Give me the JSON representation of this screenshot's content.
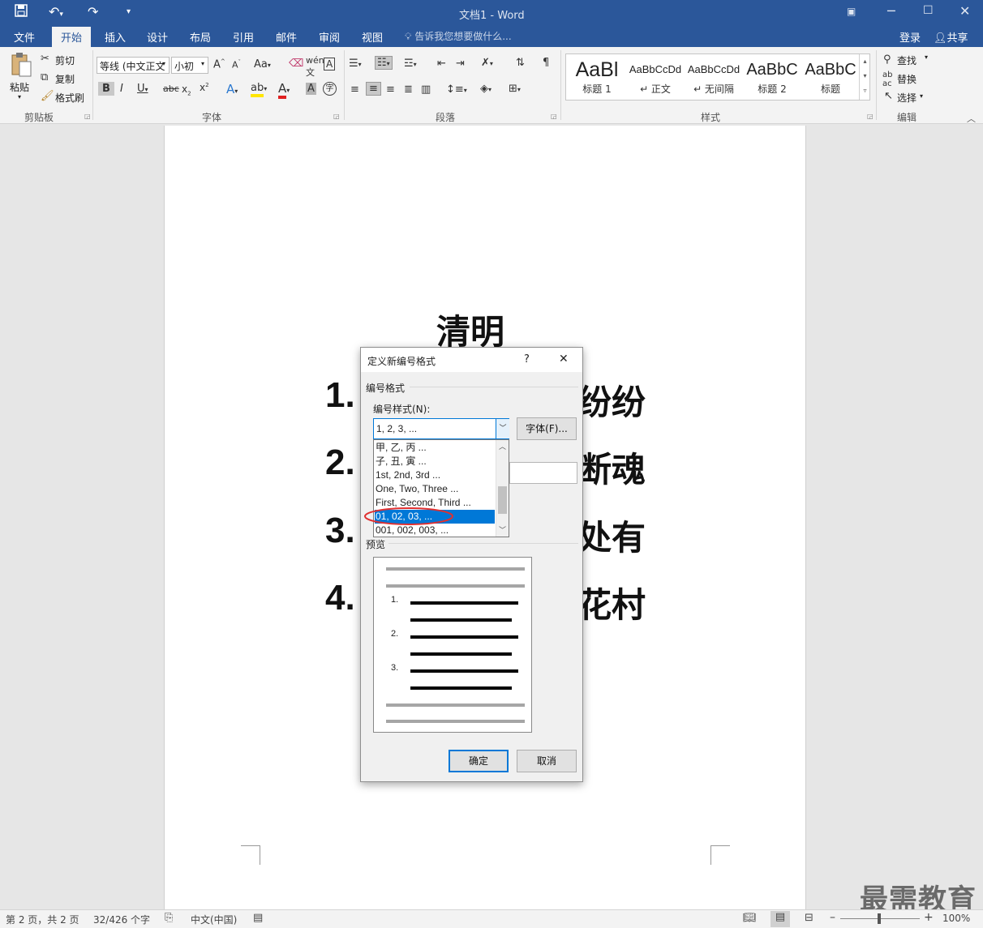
{
  "window": {
    "title": "文档1 - Word"
  },
  "qat": {
    "save_icon": "save-icon",
    "undo_icon": "undo-icon",
    "redo_icon": "redo-icon",
    "customize": "▾"
  },
  "tabs": [
    "文件",
    "开始",
    "插入",
    "设计",
    "布局",
    "引用",
    "邮件",
    "审阅",
    "视图"
  ],
  "tell_me": "告诉我您想要做什么...",
  "login": "登录",
  "share": "共享",
  "ribbon": {
    "clipboard": {
      "label": "剪贴板",
      "paste": "粘贴",
      "cut": "剪切",
      "copy": "复制",
      "format_painter": "格式刷"
    },
    "font": {
      "label": "字体",
      "font_name": "等线 (中文正文",
      "font_size": "小初"
    },
    "paragraph": {
      "label": "段落"
    },
    "styles": {
      "label": "样式",
      "items": [
        {
          "preview": "AaBl",
          "name": "标题 1"
        },
        {
          "preview": "AaBbCcDd",
          "name": "↵ 正文"
        },
        {
          "preview": "AaBbCcDd",
          "name": "↵ 无间隔"
        },
        {
          "preview": "AaBbC",
          "name": "标题 2"
        },
        {
          "preview": "AaBbC",
          "name": "标题"
        }
      ]
    },
    "editing": {
      "label": "编辑",
      "find": "查找",
      "replace": "替换",
      "select": "选择"
    }
  },
  "document": {
    "title": "清明",
    "lines": [
      {
        "num": "1.",
        "tail": "纷纷"
      },
      {
        "num": "2.",
        "tail": "断魂"
      },
      {
        "num": "3.",
        "tail": "处有"
      },
      {
        "num": "4.",
        "tail": "花村"
      }
    ]
  },
  "dialog": {
    "title": "定义新编号格式",
    "help": "?",
    "close": "✕",
    "section_label": "编号格式",
    "style_label": "编号样式(N):",
    "selected_value": "1, 2, 3, ...",
    "font_button": "字体(F)...",
    "options": [
      "甲, 乙, 丙 ...",
      "子, 丑, 寅 ...",
      "1st, 2nd, 3rd ...",
      "One, Two, Three ...",
      "First, Second, Third ...",
      "01, 02, 03, ...",
      "001, 002, 003, ..."
    ],
    "highlighted_option": "01, 02, 03, ...",
    "preview_label": "预览",
    "preview_numbers": [
      "1.",
      "2.",
      "3."
    ],
    "ok": "确定",
    "cancel": "取消"
  },
  "status": {
    "page": "第 2 页，共 2 页",
    "words": "32/426 个字",
    "language": "中文(中国)",
    "zoom": "100%"
  },
  "watermark": "最需教育",
  "colors": {
    "accent": "#2b579a",
    "selection": "#0078d7",
    "annotation": "#e03030"
  }
}
